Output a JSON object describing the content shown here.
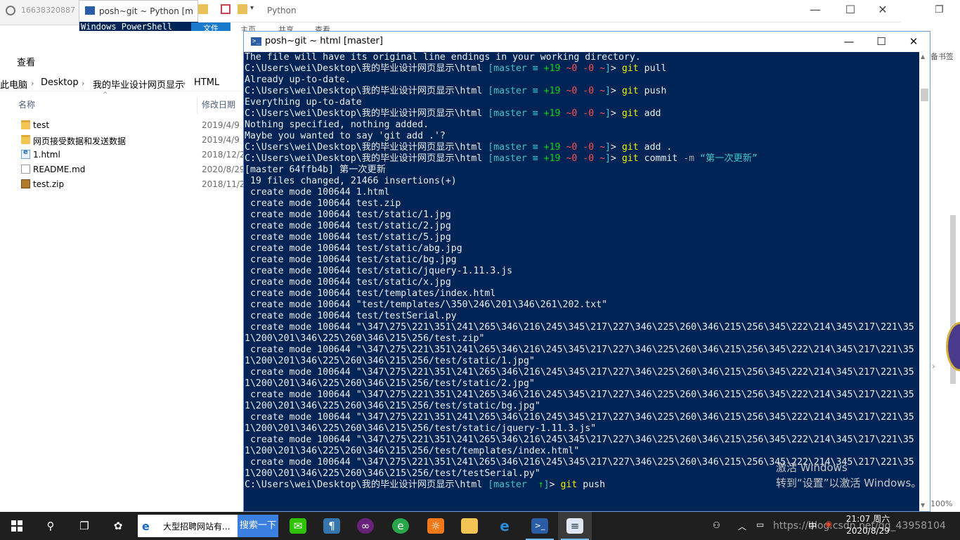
{
  "background": {
    "qq_text": "16638320887",
    "ps_back_title": "posh~git ~ Python [m",
    "ps_back_body": "Windows PowerShell",
    "explorer_title": "Python",
    "ribbon_file": "文件",
    "ribbon_tabs": [
      "主页",
      "共享",
      "查看"
    ],
    "view_tab": "查看",
    "breadcrumb": [
      "此电脑",
      "Desktop",
      "我的毕业设计网页显示",
      "HTML"
    ],
    "columns": {
      "name": "名称",
      "date": "修改日期"
    },
    "files": [
      {
        "name": "test",
        "date": "2019/4/9",
        "type": "folder"
      },
      {
        "name": "网页接受数据和发送数据",
        "date": "2019/4/9",
        "type": "folder"
      },
      {
        "name": "1.html",
        "date": "2018/12/2",
        "type": "html"
      },
      {
        "name": "README.md",
        "date": "2020/8/29",
        "type": "md"
      },
      {
        "name": "test.zip",
        "date": "2018/11/2",
        "type": "zip"
      }
    ],
    "right_notes": "备书签",
    "zoom": "100%"
  },
  "terminal": {
    "title": "posh~git ~ html [master]",
    "prompt_path": "C:\\Users\\wei\\Desktop\\我的毕业设计网页显示\\html",
    "status_branch": "[master",
    "status_equiv": "≡",
    "status_ahead": "+19",
    "status_files": "~0 -0 ~",
    "lines": [
      {
        "kind": "text",
        "text": "The file will have its original line endings in your working directory."
      },
      {
        "kind": "prompt",
        "cmd": "git",
        "args": "pull",
        "extra": ""
      },
      {
        "kind": "text",
        "text": "Already up-to-date."
      },
      {
        "kind": "prompt",
        "cmd": "git",
        "args": "push",
        "extra": ""
      },
      {
        "kind": "text",
        "text": "Everything up-to-date"
      },
      {
        "kind": "prompt",
        "cmd": "git",
        "args": "add",
        "extra": ""
      },
      {
        "kind": "text",
        "text": "Nothing specified, nothing added."
      },
      {
        "kind": "text",
        "text": "Maybe you wanted to say 'git add .'?"
      },
      {
        "kind": "prompt",
        "cmd": "git",
        "args": "add .",
        "extra": ""
      },
      {
        "kind": "prompt",
        "cmd": "git",
        "args": "commit",
        "flag": "-m",
        "extra": "“第一次更新”"
      },
      {
        "kind": "text",
        "text": "[master 64ffb4b] 第一次更新"
      },
      {
        "kind": "text",
        "text": " 19 files changed, 21466 insertions(+)"
      },
      {
        "kind": "text",
        "text": " create mode 100644 1.html"
      },
      {
        "kind": "text",
        "text": " create mode 100644 test.zip"
      },
      {
        "kind": "text",
        "text": " create mode 100644 test/static/1.jpg"
      },
      {
        "kind": "text",
        "text": " create mode 100644 test/static/2.jpg"
      },
      {
        "kind": "text",
        "text": " create mode 100644 test/static/5.jpg"
      },
      {
        "kind": "text",
        "text": " create mode 100644 test/static/abg.jpg"
      },
      {
        "kind": "text",
        "text": " create mode 100644 test/static/bg.jpg"
      },
      {
        "kind": "text",
        "text": " create mode 100644 test/static/jquery-1.11.3.js"
      },
      {
        "kind": "text",
        "text": " create mode 100644 test/static/x.jpg"
      },
      {
        "kind": "text",
        "text": " create mode 100644 test/templates/index.html"
      },
      {
        "kind": "text",
        "text": " create mode 100644 \"test/templates/\\350\\246\\201\\346\\261\\202.txt\""
      },
      {
        "kind": "text",
        "text": " create mode 100644 test/testSerial.py"
      },
      {
        "kind": "text",
        "text": " create mode 100644 \"\\347\\275\\221\\351\\241\\265\\346\\216\\245\\345\\217\\227\\346\\225\\260\\346\\215\\256\\345\\222\\214\\345\\217\\221\\35"
      },
      {
        "kind": "text",
        "text": "1\\200\\201\\346\\225\\260\\346\\215\\256/test.zip\""
      },
      {
        "kind": "text",
        "text": " create mode 100644 \"\\347\\275\\221\\351\\241\\265\\346\\216\\245\\345\\217\\227\\346\\225\\260\\346\\215\\256\\345\\222\\214\\345\\217\\221\\35"
      },
      {
        "kind": "text",
        "text": "1\\200\\201\\346\\225\\260\\346\\215\\256/test/static/1.jpg\""
      },
      {
        "kind": "text",
        "text": " create mode 100644 \"\\347\\275\\221\\351\\241\\265\\346\\216\\245\\345\\217\\227\\346\\225\\260\\346\\215\\256\\345\\222\\214\\345\\217\\221\\35"
      },
      {
        "kind": "text",
        "text": "1\\200\\201\\346\\225\\260\\346\\215\\256/test/static/2.jpg\""
      },
      {
        "kind": "text",
        "text": " create mode 100644 \"\\347\\275\\221\\351\\241\\265\\346\\216\\245\\345\\217\\227\\346\\225\\260\\346\\215\\256\\345\\222\\214\\345\\217\\221\\35"
      },
      {
        "kind": "text",
        "text": "1\\200\\201\\346\\225\\260\\346\\215\\256/test/static/bg.jpg\""
      },
      {
        "kind": "text",
        "text": " create mode 100644 \"\\347\\275\\221\\351\\241\\265\\346\\216\\245\\345\\217\\227\\346\\225\\260\\346\\215\\256\\345\\222\\214\\345\\217\\221\\35"
      },
      {
        "kind": "text",
        "text": "1\\200\\201\\346\\225\\260\\346\\215\\256/test/static/jquery-1.11.3.js\""
      },
      {
        "kind": "text",
        "text": " create mode 100644 \"\\347\\275\\221\\351\\241\\265\\346\\216\\245\\345\\217\\227\\346\\225\\260\\346\\215\\256\\345\\222\\214\\345\\217\\221\\35"
      },
      {
        "kind": "text",
        "text": "1\\200\\201\\346\\225\\260\\346\\215\\256/test/templates/index.html\""
      },
      {
        "kind": "text",
        "text": " create mode 100644 \"\\347\\275\\221\\351\\241\\265\\346\\216\\245\\345\\217\\227\\346\\225\\260\\346\\215\\256\\345\\222\\214\\345\\217\\221\\35"
      },
      {
        "kind": "text",
        "text": "1\\200\\201\\346\\225\\260\\346\\215\\256/test/testSerial.py\""
      },
      {
        "kind": "final",
        "cmd": "git",
        "args": "push"
      }
    ],
    "final_arrow": "↑]"
  },
  "watermark": {
    "line1": "激活 Windows",
    "line2": "转到“设置”以激活 Windows。"
  },
  "taskbar": {
    "ie_text": "大型招聘网站有...",
    "search_btn": "搜索一下",
    "time": "21:07 周六",
    "date": "2020/8/29",
    "ime": "中",
    "url_watermark": "https://blog.csdn.net/qq_43958104"
  },
  "colors": {
    "console_bg": "#012456",
    "branch": "#3dc6c6",
    "prompt_cmd": "#f2f200",
    "taskbar": "#1f1f1f"
  }
}
